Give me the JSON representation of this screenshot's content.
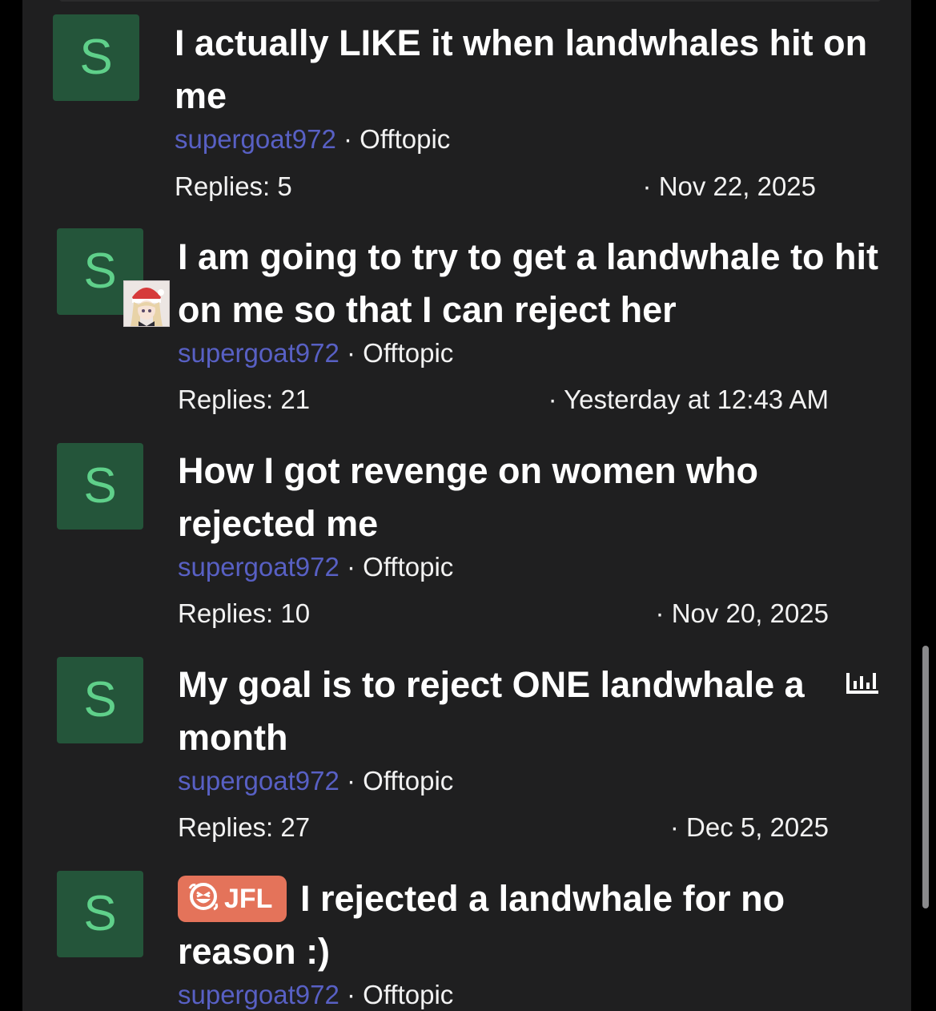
{
  "colors": {
    "background": "#1f1f20",
    "avatar_bg": "#24553a",
    "avatar_letter": "#5fd08a",
    "username": "#5860c4",
    "prefix_bg": "#e4735a"
  },
  "threads": [
    {
      "avatar_letter": "S",
      "title": "I actually LIKE it when landwhales hit on me",
      "author": "supergoat972",
      "separator": " · ",
      "forum": "Offtopic",
      "replies": "Replies: 5",
      "date": "· Nov 22, 2025"
    },
    {
      "avatar_letter": "S",
      "title": "I am going to try to get a landwhale to hit on me so that I can reject her",
      "author": "supergoat972",
      "separator": " · ",
      "forum": "Offtopic",
      "replies": "Replies: 21",
      "date": "· Yesterday at 12:43 AM"
    },
    {
      "avatar_letter": "S",
      "title": "How I got revenge on women who rejected me",
      "author": "supergoat972",
      "separator": " · ",
      "forum": "Offtopic",
      "replies": "Replies: 10",
      "date": "· Nov 20, 2025"
    },
    {
      "avatar_letter": "S",
      "title": "My goal is to reject ONE landwhale a month",
      "author": "supergoat972",
      "separator": " · ",
      "forum": "Offtopic",
      "replies": "Replies: 27",
      "date": "· Dec 5, 2025",
      "icon": "poll-icon"
    },
    {
      "avatar_letter": "S",
      "prefix": "JFL",
      "prefix_icon": "laughing-emoji-icon",
      "title": "I rejected a landwhale for no reason :)",
      "author": "supergoat972",
      "separator": " · ",
      "forum": "Offtopic"
    }
  ]
}
